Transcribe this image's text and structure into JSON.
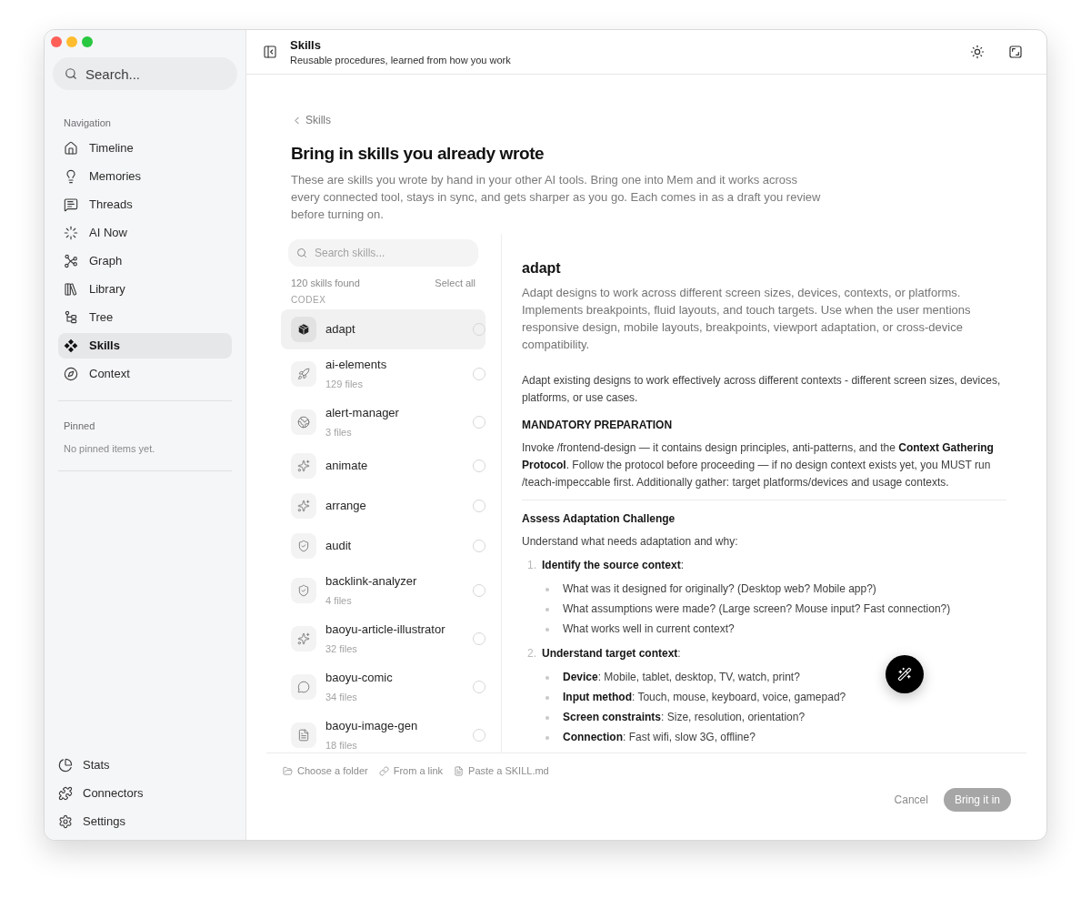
{
  "sidebar": {
    "search": {
      "placeholder": "Search..."
    },
    "nav_heading": "Navigation",
    "nav_items": [
      {
        "label": "Timeline",
        "selected": false
      },
      {
        "label": "Memories",
        "selected": false
      },
      {
        "label": "Threads",
        "selected": false
      },
      {
        "label": "AI Now",
        "selected": false
      },
      {
        "label": "Graph",
        "selected": false
      },
      {
        "label": "Library",
        "selected": false
      },
      {
        "label": "Tree",
        "selected": false
      },
      {
        "label": "Skills",
        "selected": true
      },
      {
        "label": "Context",
        "selected": false
      }
    ],
    "pinned_heading": "Pinned",
    "pinned_empty": "No pinned items yet.",
    "footer_items": [
      {
        "label": "Stats"
      },
      {
        "label": "Connectors"
      },
      {
        "label": "Settings"
      }
    ]
  },
  "header": {
    "title": "Skills",
    "subtitle": "Reusable procedures, learned from how you work"
  },
  "page": {
    "back_link": "Skills",
    "title": "Bring in skills you already wrote",
    "intro": "These are skills you wrote by hand in your other AI tools. Bring one into Mem and it works across every connected tool, stays in sync, and gets sharper as you go. Each comes in as a draft you review before turning on."
  },
  "skills_list": {
    "search": {
      "placeholder": "Search skills..."
    },
    "count": "120 skills found",
    "select_all": "Select all",
    "group": "CODEX",
    "items": [
      {
        "name": "adapt",
        "selected": true,
        "checked": false
      },
      {
        "name": "ai-elements",
        "files": "129 files",
        "selected": false,
        "checked": false
      },
      {
        "name": "alert-manager",
        "files": "3 files",
        "selected": false,
        "checked": false
      },
      {
        "name": "animate",
        "selected": false,
        "checked": false
      },
      {
        "name": "arrange",
        "selected": false,
        "checked": false
      },
      {
        "name": "audit",
        "selected": false,
        "checked": false
      },
      {
        "name": "backlink-analyzer",
        "files": "4 files",
        "selected": false,
        "checked": false
      },
      {
        "name": "baoyu-article-illustrator",
        "files": "32 files",
        "selected": false,
        "checked": false
      },
      {
        "name": "baoyu-comic",
        "files": "34 files",
        "selected": false,
        "checked": false
      },
      {
        "name": "baoyu-image-gen",
        "files": "18 files",
        "selected": false,
        "checked": false
      }
    ]
  },
  "detail": {
    "title": "adapt",
    "description": "Adapt designs to work across different screen sizes, devices, contexts, or platforms. Implements breakpoints, fluid layouts, and touch targets. Use when the user mentions responsive design, mobile layouts, breakpoints, viewport adaptation, or cross-device compatibility.",
    "body": [
      {
        "kind": "paragraph",
        "text": "Adapt existing designs to work effectively across different contexts - different screen sizes, devices, platforms, or use cases."
      },
      {
        "kind": "heading",
        "text": "MANDATORY PREPARATION"
      },
      {
        "kind": "paragraph",
        "text": "Invoke /frontend-design — it contains design principles, anti-patterns, and the **Context Gathering Protocol**. Follow the protocol before proceeding — if no design context exists yet, you MUST run /teach-impeccable first. Additionally gather: target platforms/devices and usage contexts."
      },
      {
        "kind": "rule"
      },
      {
        "kind": "heading",
        "text": "Assess Adaptation Challenge"
      },
      {
        "kind": "paragraph",
        "text": "Understand what needs adaptation and why:"
      },
      {
        "kind": "numbered_list",
        "items": [
          {
            "number": "1.",
            "text": "**Identify the source context**:",
            "children": [
              {
                "text": "What was it designed for originally? (Desktop web? Mobile app?)"
              },
              {
                "text": "What assumptions were made? (Large screen? Mouse input? Fast connection?)"
              },
              {
                "text": "What works well in current context?"
              }
            ]
          },
          {
            "number": "2.",
            "text": "**Understand target context**:",
            "children": [
              {
                "text": "**Device**: Mobile, tablet, desktop, TV, watch, print?"
              },
              {
                "text": "**Input method**: Touch, mouse, keyboard, voice, gamepad?"
              },
              {
                "text": "**Screen constraints**: Size, resolution, orientation?"
              },
              {
                "text": "**Connection**: Fast wifi, slow 3G, offline?"
              }
            ]
          }
        ]
      }
    ]
  },
  "footer": {
    "sources": [
      {
        "label": "Choose a folder"
      },
      {
        "label": "From a link"
      },
      {
        "label": "Paste a SKILL.md"
      }
    ],
    "cancel": "Cancel",
    "confirm": {
      "label": "Bring it in",
      "disabled": true
    }
  }
}
